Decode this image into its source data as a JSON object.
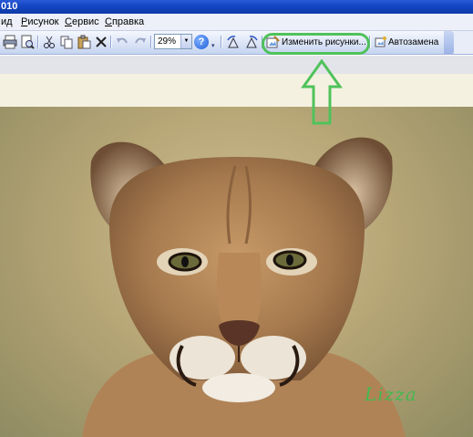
{
  "window": {
    "title": "010"
  },
  "menu": {
    "items": [
      {
        "label": "ид",
        "underline": ""
      },
      {
        "label": "Рисунок",
        "underline": "Р"
      },
      {
        "label": "Сервис",
        "underline": "С"
      },
      {
        "label": "Справка",
        "underline": "С"
      }
    ]
  },
  "toolbar": {
    "zoom_value": "29%",
    "edit_pictures_label": "Изменить рисунки...",
    "autoreplace_label": "Автозамена",
    "icons": [
      "print-icon",
      "print-preview-icon",
      "cut-icon",
      "copy-icon",
      "paste-icon",
      "delete-icon",
      "undo-icon",
      "redo-icon",
      "help-icon",
      "rotate-left-icon",
      "rotate-right-icon",
      "edit-pictures-icon",
      "autoreplace-icon"
    ]
  },
  "annotation": {
    "color": "#4fc25a"
  },
  "image": {
    "subject": "cougar",
    "signature": "Lizza"
  }
}
